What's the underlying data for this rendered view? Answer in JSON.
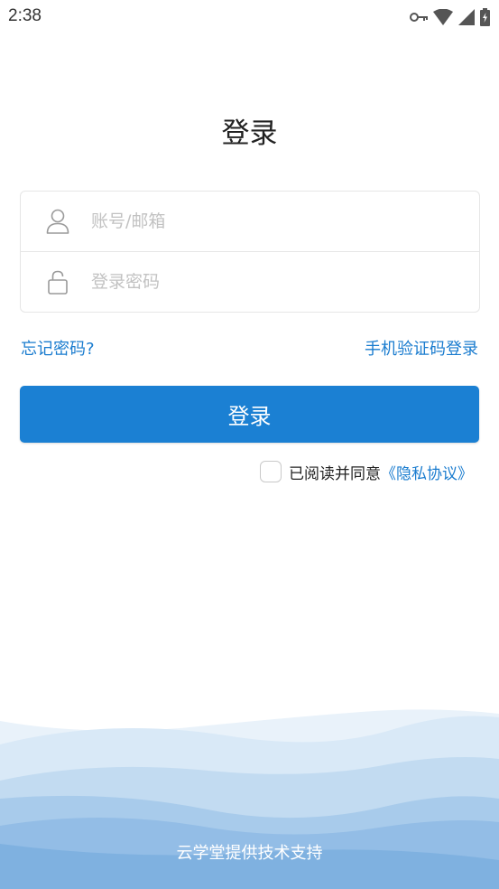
{
  "status_bar": {
    "time": "2:38",
    "icons": [
      "vpn-key-icon",
      "wifi-icon",
      "signal-icon",
      "battery-charging-icon"
    ]
  },
  "page": {
    "title": "登录"
  },
  "form": {
    "account_placeholder": "账号/邮箱",
    "account_value": "",
    "password_placeholder": "登录密码",
    "password_value": "",
    "account_icon": "user-icon",
    "password_icon": "lock-icon"
  },
  "links": {
    "forgot_password": "忘记密码?",
    "sms_login": "手机验证码登录"
  },
  "login_button": {
    "label": "登录"
  },
  "agreement": {
    "checked": false,
    "text": "已阅读并同意",
    "link": "《隐私协议》"
  },
  "footer": {
    "text": "云学堂提供技术支持"
  },
  "colors": {
    "primary": "#1b80d3",
    "link": "#1a7ccf",
    "wave_light": "#e3eff9",
    "wave_mid": "#c3dcf1",
    "wave_dark": "#8fbbe3"
  }
}
